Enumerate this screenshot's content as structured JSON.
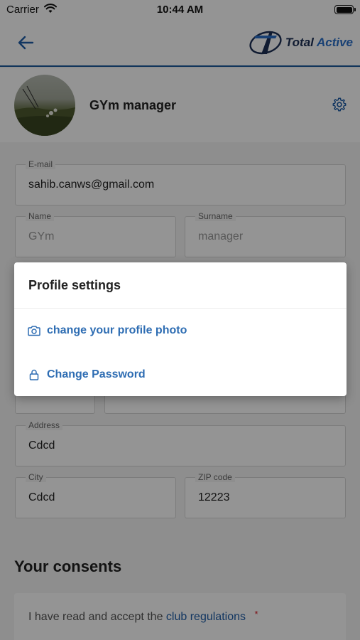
{
  "status_bar": {
    "carrier": "Carrier",
    "time": "10:44 AM"
  },
  "header": {
    "logo_text_1": "Total",
    "logo_text_2": "Active",
    "accent_color": "#1c5a9c"
  },
  "profile": {
    "name": "GYm manager"
  },
  "form": {
    "email": {
      "label": "E-mail",
      "value": "sahib.canws@gmail.com"
    },
    "name": {
      "label": "Name",
      "value": "GYm"
    },
    "surname": {
      "label": "Surname",
      "value": "manager"
    },
    "address": {
      "label": "Address",
      "value": "Cdcd"
    },
    "city": {
      "label": "City",
      "value": "Cdcd"
    },
    "zip": {
      "label": "ZIP code",
      "value": "12223"
    }
  },
  "consents": {
    "title": "Your consents",
    "text": "I have read and accept the",
    "link": "club regulations",
    "required_marker": "*"
  },
  "modal": {
    "title": "Profile settings",
    "items": [
      {
        "label": "change your profile photo",
        "icon": "camera-icon"
      },
      {
        "label": "Change Password",
        "icon": "lock-icon"
      }
    ]
  }
}
